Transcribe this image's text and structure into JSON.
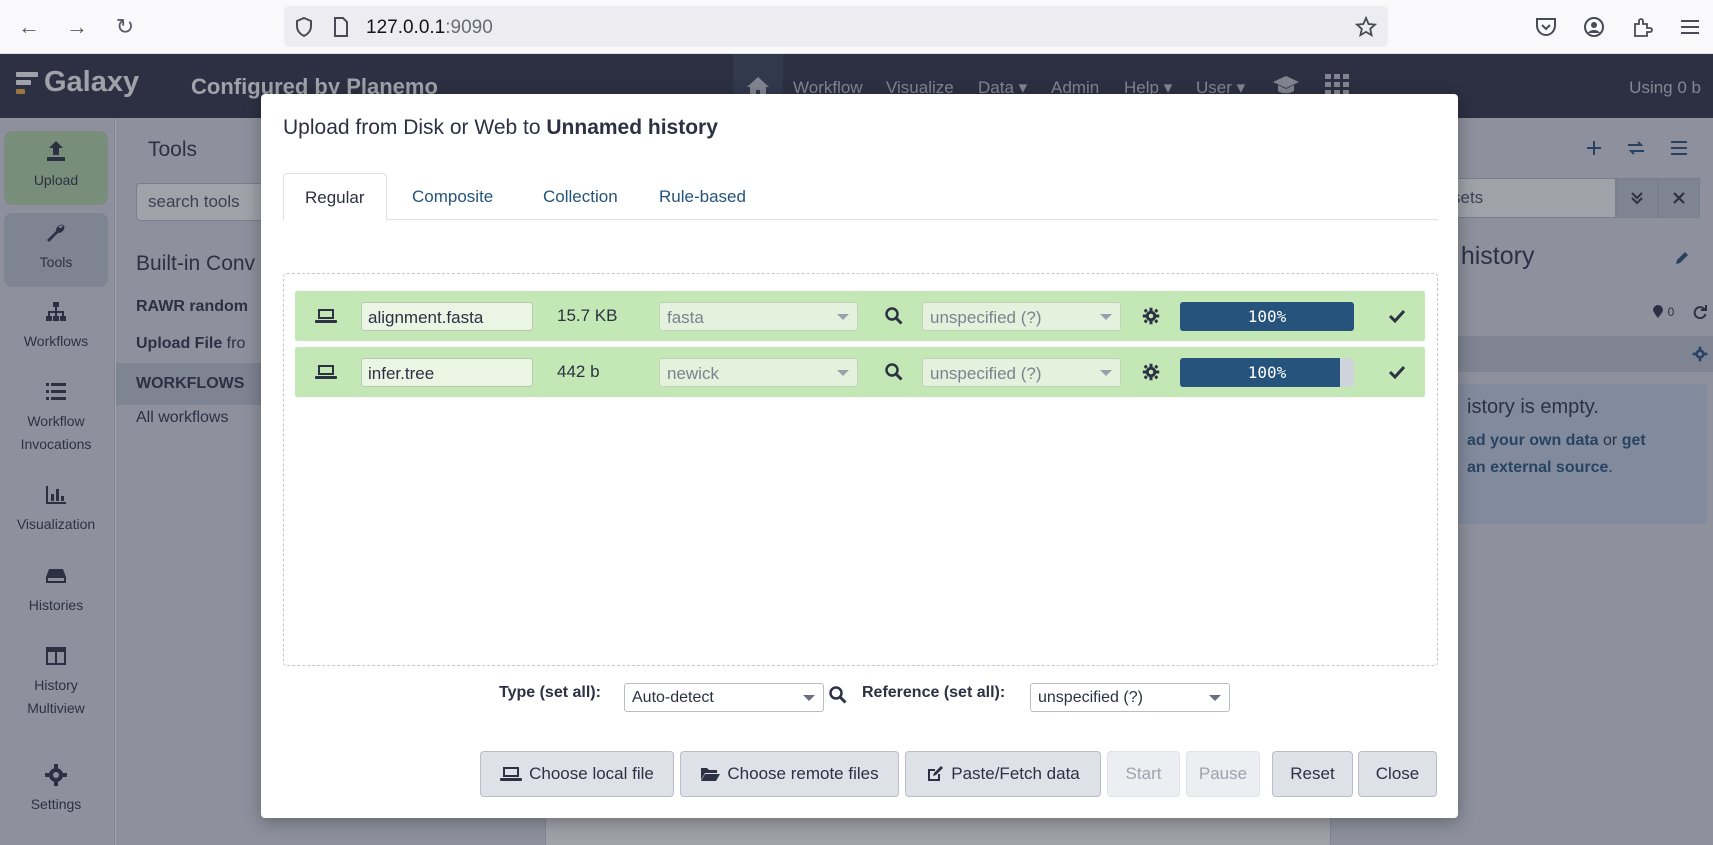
{
  "browser": {
    "url_host": "127.0.0.1",
    "url_port": ":9090"
  },
  "masthead": {
    "brand": "Galaxy",
    "subtitle": "Configured by Planemo",
    "nav": [
      "Workflow",
      "Visualize",
      "Data",
      "Admin",
      "Help",
      "User"
    ],
    "using": "Using 0 b"
  },
  "activity": {
    "upload": "Upload",
    "tools": "Tools",
    "workflows": "Workflows",
    "invocations": [
      "Workflow",
      "Invocations"
    ],
    "visualization": "Visualization",
    "histories": "Histories",
    "multiview": [
      "History",
      "Multiview"
    ],
    "settings": "Settings"
  },
  "toolpanel": {
    "title": "Tools",
    "search_placeholder": "search tools",
    "section": "Built-in Conv",
    "tool1": "RAWR random",
    "tool2_bold": "Upload File",
    "tool2_rest": " fro",
    "workflows": "WORKFLOWS",
    "all_workflows": "All workflows"
  },
  "history": {
    "search_fragment": "sets",
    "name_fragment": "d history",
    "count": "0",
    "empty_title": "istory is empty.",
    "empty_l1a": "ad your own data",
    "empty_l1b": " or ",
    "empty_l1c": "get",
    "empty_l2": "an external source",
    "empty_l2_end": "."
  },
  "modal": {
    "title_prefix": "Upload from Disk or Web to ",
    "title_history": "Unnamed history",
    "tabs": [
      "Regular",
      "Composite",
      "Collection",
      "Rule-based"
    ],
    "active_tab": "Regular",
    "rows": [
      {
        "name": "alignment.fasta",
        "size": "15.7 KB",
        "type": "fasta",
        "genome": "unspecified (?)",
        "progress": "100%",
        "fill": 1.0
      },
      {
        "name": "infer.tree",
        "size": "442 b",
        "type": "newick",
        "genome": "unspecified (?)",
        "progress": "100%",
        "fill": 0.92
      }
    ],
    "type_label": "Type (set all):",
    "type_value": "Auto-detect",
    "ref_label": "Reference (set all):",
    "ref_value": "unspecified (?)",
    "buttons": {
      "local": "Choose local file",
      "remote": "Choose remote files",
      "paste": "Paste/Fetch data",
      "start": "Start",
      "pause": "Pause",
      "reset": "Reset",
      "close": "Close"
    }
  },
  "colors": {
    "masthead": "#2c3143",
    "row_success": "#c4e8b5",
    "progress": "#25537b"
  }
}
